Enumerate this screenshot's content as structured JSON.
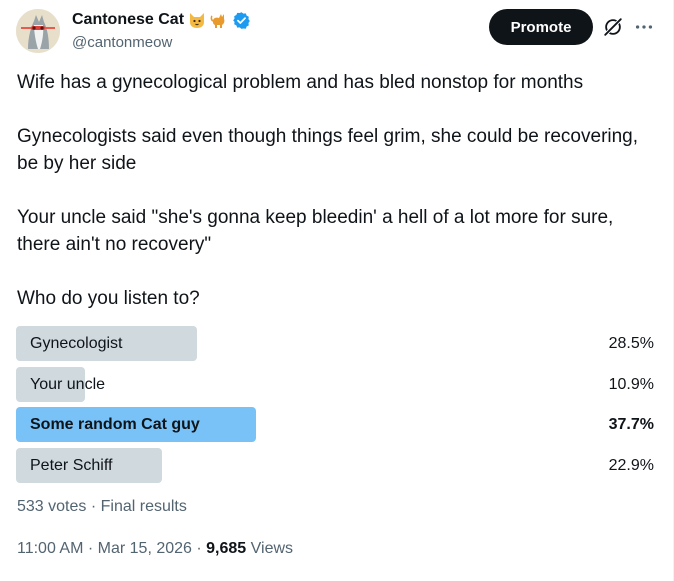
{
  "author": {
    "display_name": "Cantonese Cat",
    "handle": "@cantonmeow",
    "emojis": [
      "cat-face-emoji",
      "cat-emoji"
    ],
    "verified": true,
    "verified_color": "#1d9bf0"
  },
  "header": {
    "promote_label": "Promote",
    "grok_icon": "grok-icon",
    "more_icon": "more-icon"
  },
  "tweet": {
    "paragraphs": [
      "Wife has a gynecological problem and has bled nonstop for months",
      "Gynecologists said even though things feel grim, she could be recovering, be by her side",
      "Your uncle said \"she's gonna keep bleedin' a hell of a lot more for sure, there ain't no recovery\"",
      "Who do you listen to?"
    ]
  },
  "poll": {
    "options": [
      {
        "label": "Gynecologist",
        "percent": "28.5%",
        "value": 28.5,
        "winner": false
      },
      {
        "label": "Your uncle",
        "percent": "10.9%",
        "value": 10.9,
        "winner": false
      },
      {
        "label": "Some random Cat guy",
        "percent": "37.7%",
        "value": 37.7,
        "winner": true
      },
      {
        "label": "Peter Schiff",
        "percent": "22.9%",
        "value": 22.9,
        "winner": false
      }
    ],
    "votes": "533 votes",
    "separator": " · ",
    "status": "Final results",
    "bar_color": "#cfd9de",
    "winner_color": "#79c2f7"
  },
  "footer": {
    "time": "11:00 AM",
    "separator": " · ",
    "date": "Mar 15, 2026",
    "views_count": "9,685",
    "views_label": " Views"
  }
}
